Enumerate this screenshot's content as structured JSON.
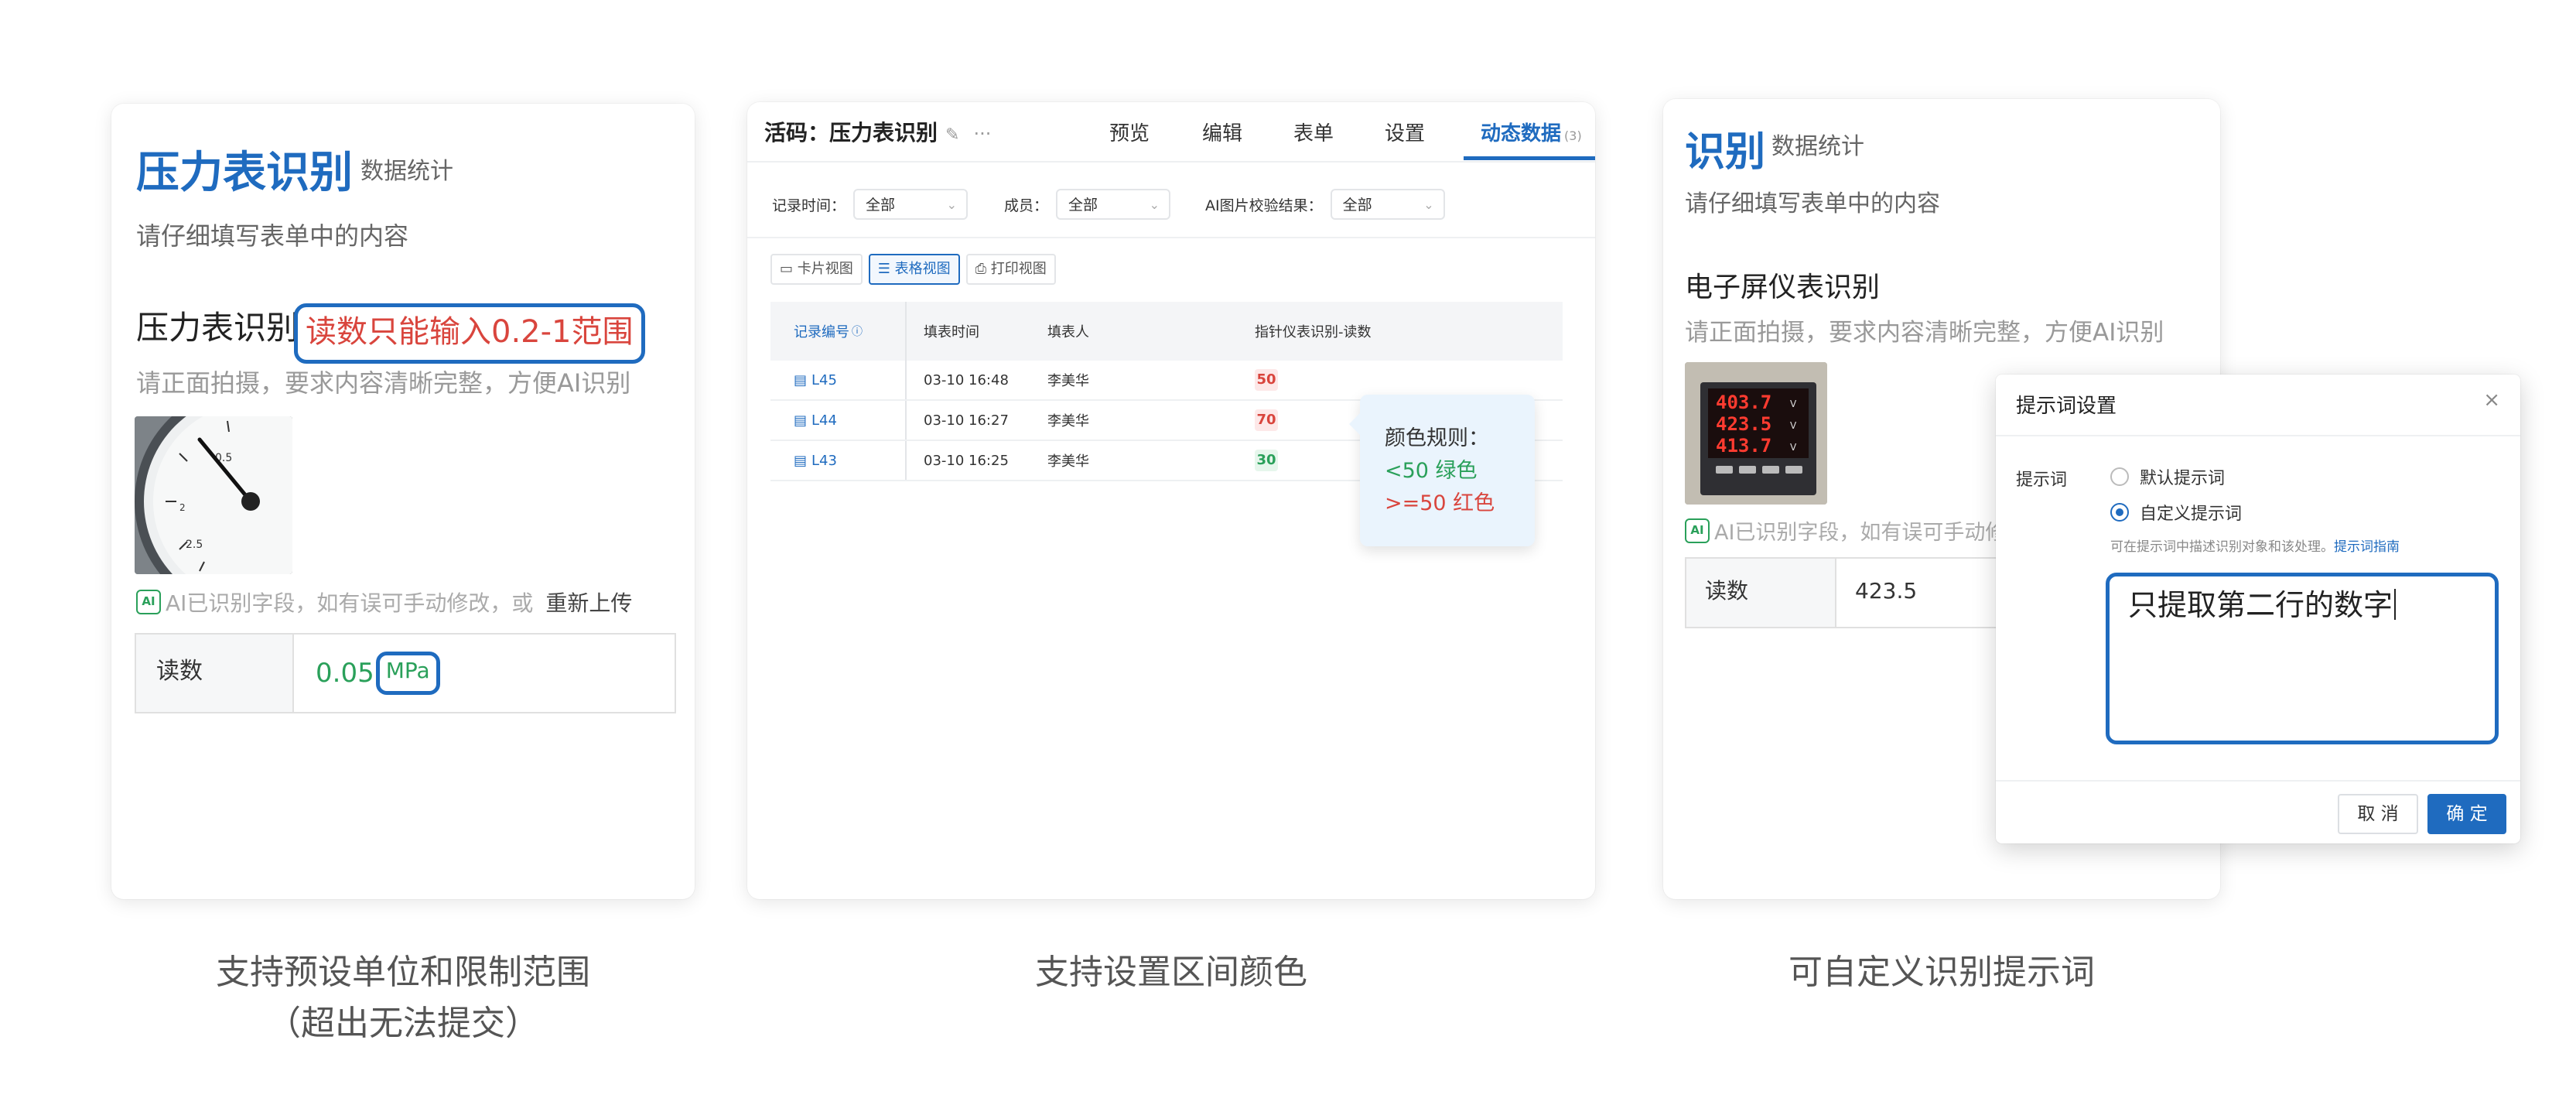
{
  "card1": {
    "title": "压力表识别",
    "subtitle": "数据统计",
    "description": "请仔细填写表单中的内容",
    "field_label": "压力表识别",
    "range_warning": "读数只能输入0.2-1范围",
    "hint": "请正面拍摄，要求内容清晰完整，方便AI识别",
    "ai_badge": "AI",
    "ai_notice": "AI已识别字段，如有误可手动修改，或",
    "reupload": "重新上传",
    "reading_label": "读数",
    "reading_value": "0.05",
    "reading_unit": "MPa"
  },
  "card2": {
    "title": "活码：压力表识别",
    "edit_icon": "✎",
    "more_icon": "···",
    "tabs": [
      {
        "label": "预览"
      },
      {
        "label": "编辑"
      },
      {
        "label": "表单"
      },
      {
        "label": "设置"
      },
      {
        "label": "动态数据",
        "count": "(3)"
      }
    ],
    "filters": [
      {
        "label": "记录时间：",
        "value": "全部"
      },
      {
        "label": "成员：",
        "value": "全部"
      },
      {
        "label": "AI图片校验结果：",
        "value": "全部"
      }
    ],
    "views": [
      {
        "label": "卡片视图"
      },
      {
        "label": "表格视图"
      },
      {
        "label": "打印视图"
      }
    ],
    "columns": [
      "记录编号",
      "填表时间",
      "填表人",
      "指针仪表识别-读数"
    ],
    "rows": [
      {
        "id": "L45",
        "time": "03-10 16:48",
        "user": "李美华",
        "reading": "50",
        "status": "red"
      },
      {
        "id": "L44",
        "time": "03-10 16:27",
        "user": "李美华",
        "reading": "70",
        "status": "red"
      },
      {
        "id": "L43",
        "time": "03-10 16:25",
        "user": "李美华",
        "reading": "30",
        "status": "green"
      }
    ],
    "tooltip": {
      "title": "颜色规则：",
      "rule_green": "<50 绿色",
      "rule_red": ">=50 红色"
    }
  },
  "card3": {
    "title": "识别",
    "subtitle": "数据统计",
    "description": "请仔细填写表单中的内容",
    "field_label": "电子屏仪表识别",
    "hint": "请正面拍摄，要求内容清晰完整，方便AI识别",
    "ai_badge": "AI",
    "ai_notice": "AI已识别字段，如有误可手动修改",
    "reading_label": "读数",
    "reading_value": "423.5"
  },
  "dialog": {
    "title": "提示词设置",
    "close_icon": "×",
    "field_label": "提示词",
    "option_default": "默认提示词",
    "option_custom": "自定义提示词",
    "note": "可在提示词中描述识别对象和该处理。",
    "note_link": "提示词指南",
    "textarea_value": "只提取第二行的数字",
    "cancel_label": "取 消",
    "ok_label": "确 定"
  },
  "captions": {
    "caption1_line1": "支持预设单位和限制范围",
    "caption1_line2": "（超出无法提交）",
    "caption2": "支持设置区间颜色",
    "caption3": "可自定义识别提示词"
  },
  "colors": {
    "accent": "#1f6bbf",
    "red": "#d9453d",
    "green": "#2aa05a"
  }
}
